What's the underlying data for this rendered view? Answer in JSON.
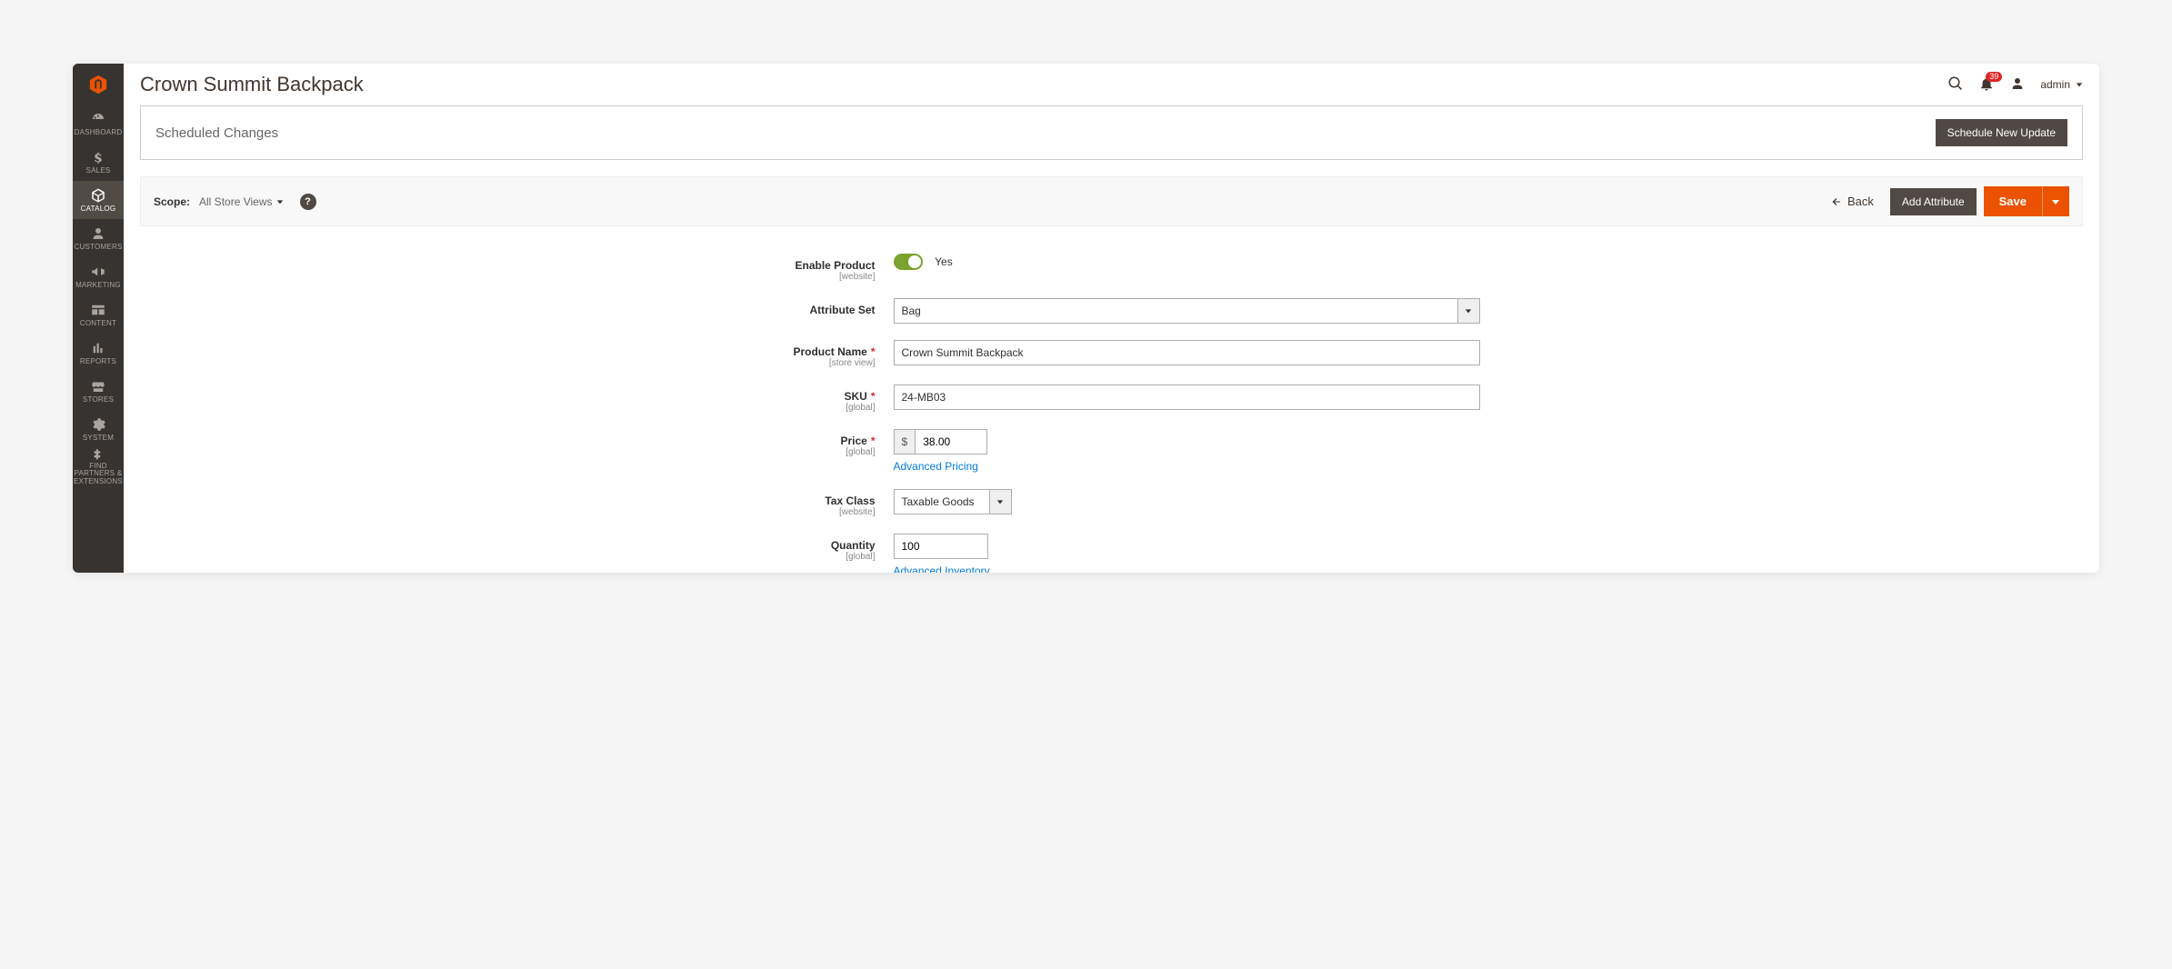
{
  "page_title": "Crown Summit Backpack",
  "header": {
    "notification_count": "39",
    "user_label": "admin"
  },
  "sidebar": {
    "items": [
      {
        "label": "DASHBOARD"
      },
      {
        "label": "SALES"
      },
      {
        "label": "CATALOG"
      },
      {
        "label": "CUSTOMERS"
      },
      {
        "label": "MARKETING"
      },
      {
        "label": "CONTENT"
      },
      {
        "label": "REPORTS"
      },
      {
        "label": "STORES"
      },
      {
        "label": "SYSTEM"
      },
      {
        "label": "FIND PARTNERS & EXTENSIONS"
      }
    ]
  },
  "scheduled": {
    "title": "Scheduled Changes",
    "button": "Schedule New Update"
  },
  "scope_bar": {
    "label": "Scope:",
    "value": "All Store Views",
    "back": "Back",
    "add_attribute": "Add Attribute",
    "save": "Save"
  },
  "form": {
    "enable_product": {
      "label": "Enable Product",
      "hint": "[website]",
      "value_text": "Yes"
    },
    "attribute_set": {
      "label": "Attribute Set",
      "value": "Bag"
    },
    "product_name": {
      "label": "Product Name",
      "hint": "[store view]",
      "value": "Crown Summit Backpack"
    },
    "sku": {
      "label": "SKU",
      "hint": "[global]",
      "value": "24-MB03"
    },
    "price": {
      "label": "Price",
      "hint": "[global]",
      "currency": "$",
      "value": "38.00",
      "advanced_link": "Advanced Pricing"
    },
    "tax_class": {
      "label": "Tax Class",
      "hint": "[website]",
      "value": "Taxable Goods"
    },
    "quantity": {
      "label": "Quantity",
      "hint": "[global]",
      "value": "100",
      "advanced_link": "Advanced Inventory"
    }
  }
}
